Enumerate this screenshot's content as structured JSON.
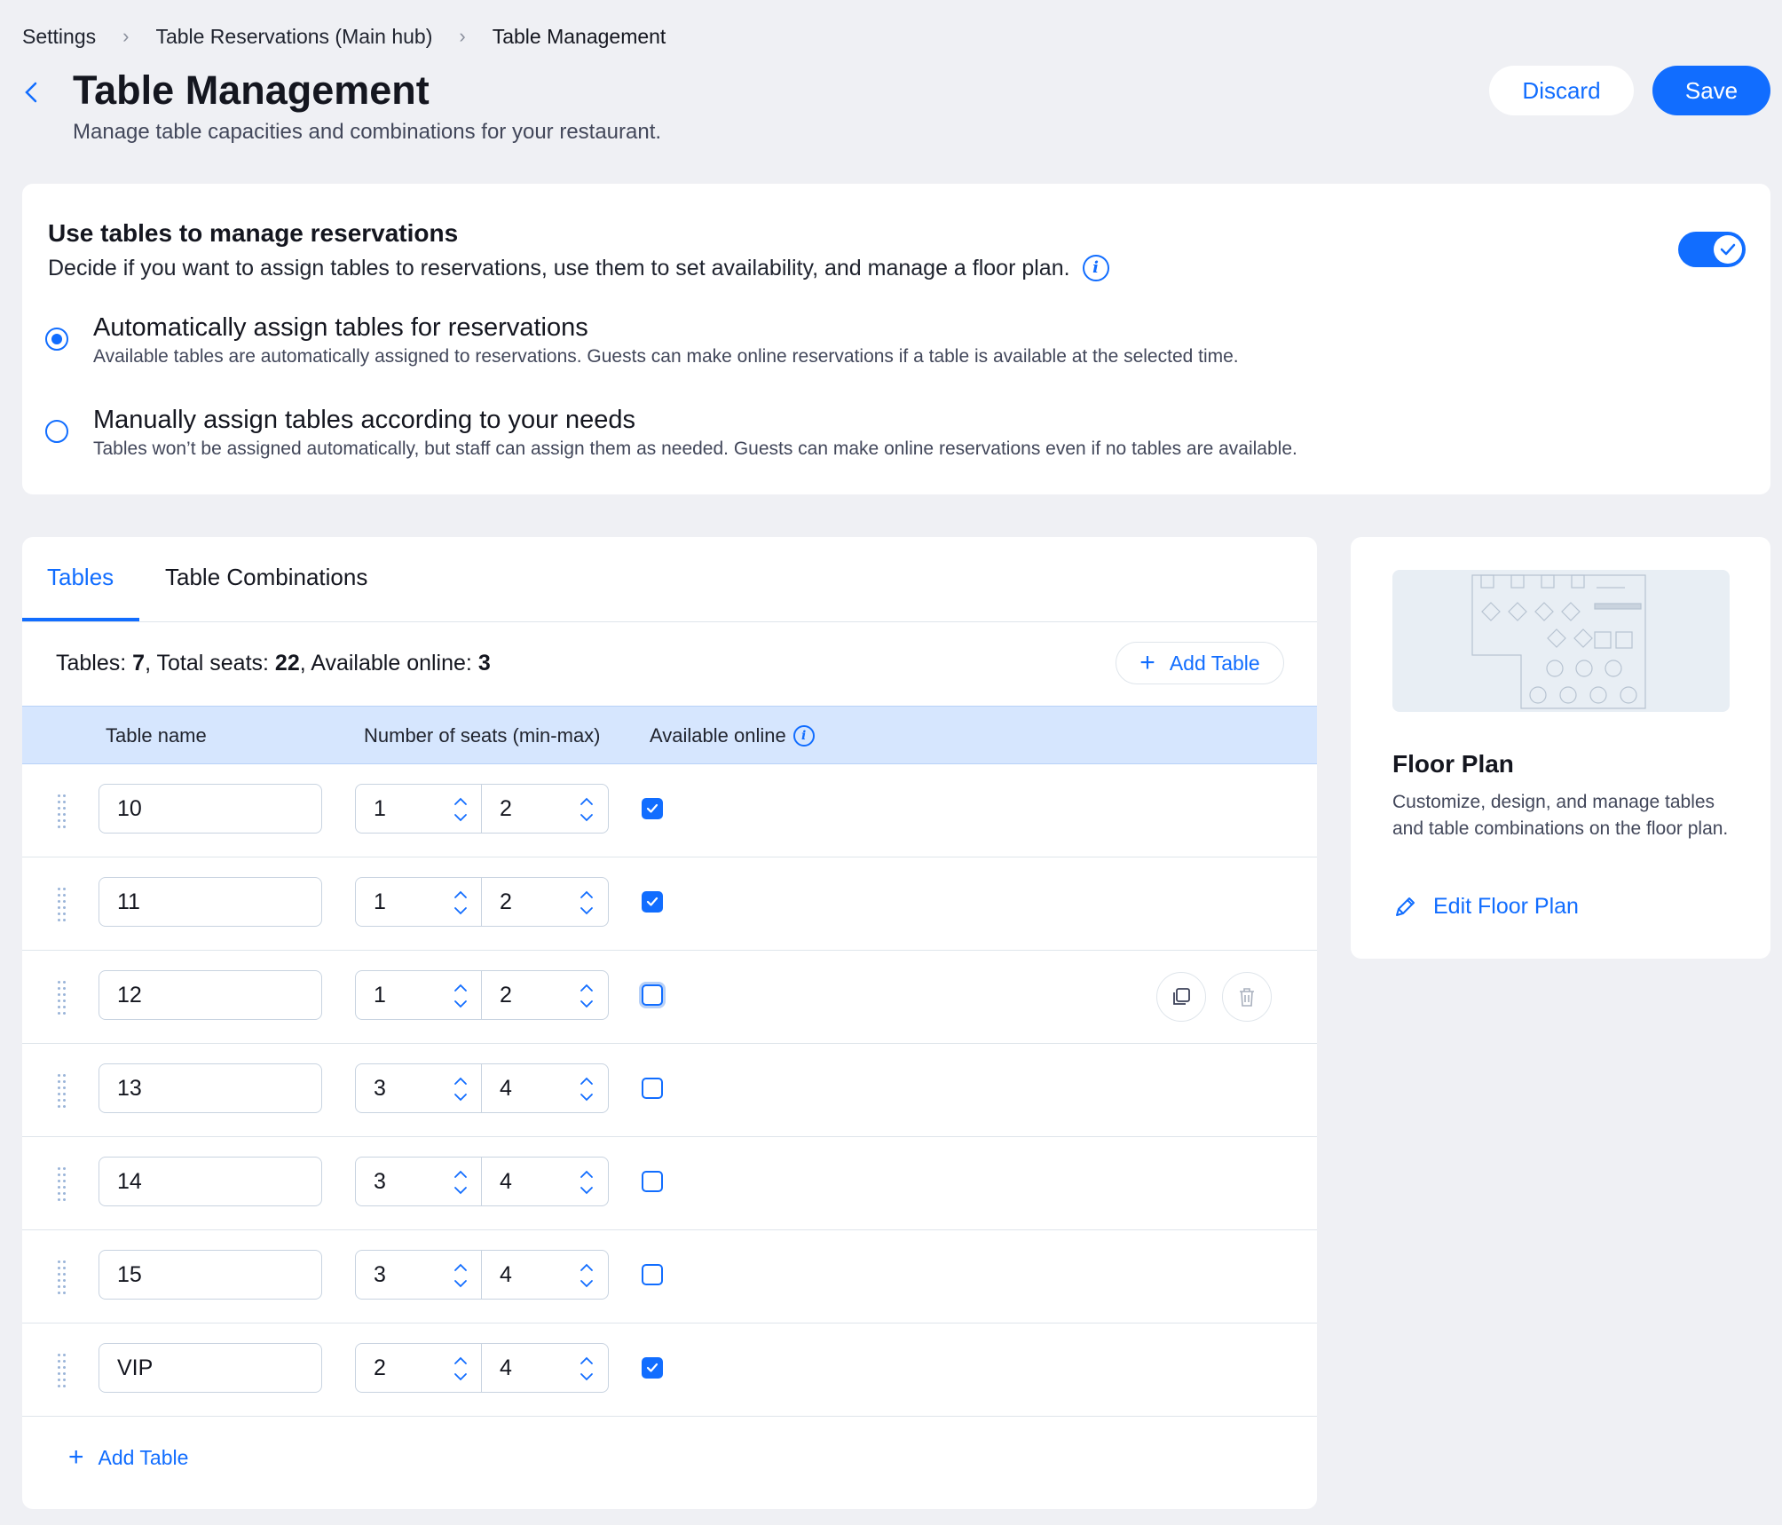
{
  "breadcrumb": {
    "items": [
      "Settings",
      "Table Reservations (Main hub)",
      "Table Management"
    ]
  },
  "header": {
    "title": "Table Management",
    "subtitle": "Manage table capacities and combinations for your restaurant.",
    "discard_label": "Discard",
    "save_label": "Save"
  },
  "reservations": {
    "title": "Use tables to manage reservations",
    "description": "Decide if you want to assign tables to reservations, use them to set availability, and manage a floor plan.",
    "toggle_on": true,
    "options": [
      {
        "title": "Automatically assign tables for reservations",
        "description": "Available tables are automatically assigned to reservations. Guests can make online reservations if a table is available at the selected time.",
        "selected": true
      },
      {
        "title": "Manually assign tables according to your needs",
        "description": "Tables won’t be assigned automatically, but staff can assign them as needed. Guests can make online reservations even if no tables are available.",
        "selected": false
      }
    ]
  },
  "tables_panel": {
    "tabs": [
      "Tables",
      "Table Combinations"
    ],
    "active_tab": "Tables",
    "summary": {
      "tables_label": "Tables: ",
      "tables_value": "7",
      "seats_label": ", Total seats: ",
      "seats_value": "22",
      "online_label": ", Available online: ",
      "online_value": "3"
    },
    "add_table_label": "Add Table",
    "columns": {
      "name": "Table name",
      "seats": "Number of seats (min-max)",
      "online": "Available online"
    },
    "rows": [
      {
        "name": "10",
        "min": "1",
        "max": "2",
        "online": true
      },
      {
        "name": "11",
        "min": "1",
        "max": "2",
        "online": true
      },
      {
        "name": "12",
        "min": "1",
        "max": "2",
        "online": false
      },
      {
        "name": "13",
        "min": "3",
        "max": "4",
        "online": false
      },
      {
        "name": "14",
        "min": "3",
        "max": "4",
        "online": false
      },
      {
        "name": "15",
        "min": "3",
        "max": "4",
        "online": false
      },
      {
        "name": "VIP",
        "min": "2",
        "max": "4",
        "online": true
      }
    ],
    "add_table_bottom_label": "Add Table"
  },
  "floor_plan": {
    "title": "Floor Plan",
    "description": "Customize, design, and manage tables and table combinations on the floor plan.",
    "edit_label": "Edit Floor Plan"
  },
  "colors": {
    "accent": "#116dff",
    "background": "#eff0f4",
    "table_header": "#d6e6fe"
  }
}
